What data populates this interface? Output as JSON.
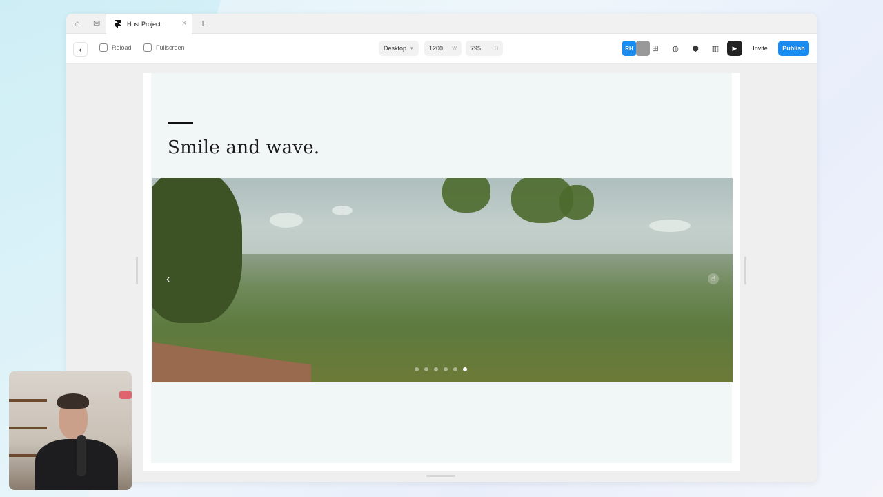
{
  "tabbar": {
    "home_icon": "home-icon",
    "inbox_icon": "inbox-icon",
    "tab_title": "Host Project",
    "tab_close": "×",
    "new_tab": "+"
  },
  "toolbar": {
    "back": "‹",
    "reload_label": "Reload",
    "fullscreen_label": "Fullscreen",
    "breakpoint": "Desktop",
    "width_value": "1200",
    "width_unit": "W",
    "height_value": "795",
    "height_unit": "H",
    "user_badge": "RH",
    "invite_label": "Invite",
    "publish_label": "Publish"
  },
  "page": {
    "headline": "Smile and wave.",
    "slideshow": {
      "prev": "‹",
      "dot_count": 6,
      "active_dot": 6
    }
  },
  "colors": {
    "accent": "#1a8cf0",
    "canvas_bg": "#f1f6f6"
  }
}
